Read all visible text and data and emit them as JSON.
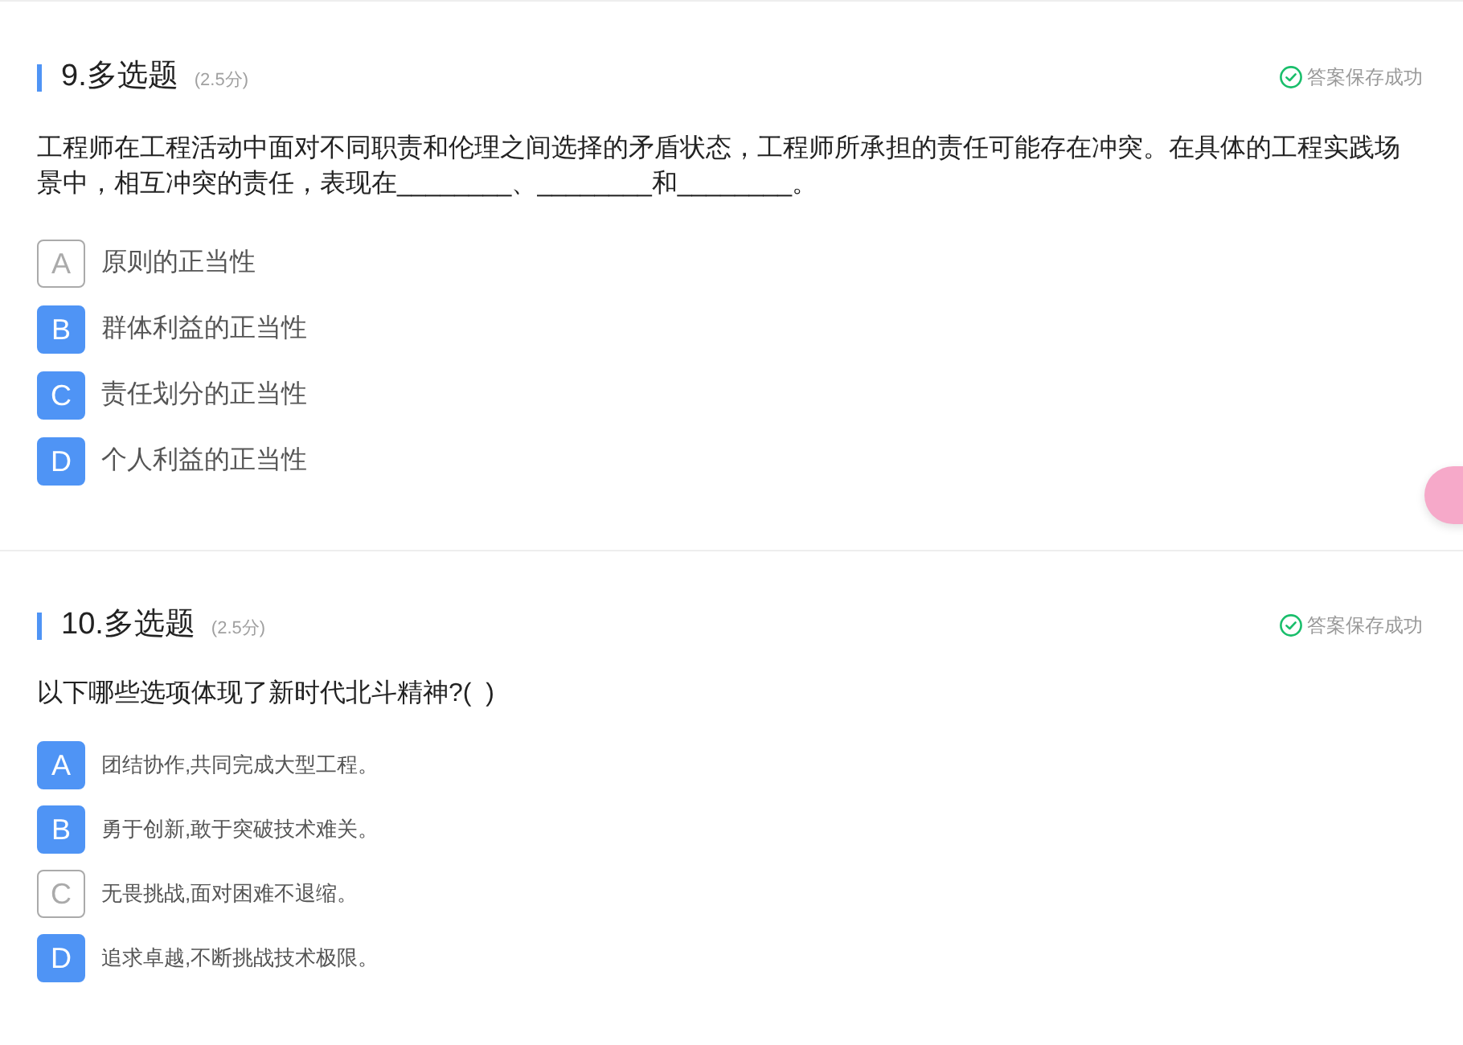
{
  "questions": [
    {
      "title": "9.多选题",
      "score": "(2.5分)",
      "save_status": "答案保存成功",
      "text": "工程师在工程活动中面对不同职责和伦理之间选择的矛盾状态，工程师所承担的责任可能存在冲突。在具体的工程实践场景中，相互冲突的责任，表现在________、________和________。",
      "options": [
        {
          "letter": "A",
          "text": "原则的正当性",
          "selected": false
        },
        {
          "letter": "B",
          "text": "群体利益的正当性",
          "selected": true
        },
        {
          "letter": "C",
          "text": "责任划分的正当性",
          "selected": true
        },
        {
          "letter": "D",
          "text": "个人利益的正当性",
          "selected": true
        }
      ]
    },
    {
      "title": "10.多选题",
      "score": "(2.5分)",
      "save_status": "答案保存成功",
      "text": "以下哪些选项体现了新时代北斗精神?(  )",
      "options": [
        {
          "letter": "A",
          "text": "团结协作,共同完成大型工程。",
          "selected": true
        },
        {
          "letter": "B",
          "text": "勇于创新,敢于突破技术难关。",
          "selected": true
        },
        {
          "letter": "C",
          "text": "无畏挑战,面对困难不退缩。",
          "selected": false
        },
        {
          "letter": "D",
          "text": "追求卓越,不断挑战技术极限。",
          "selected": true
        }
      ]
    }
  ]
}
